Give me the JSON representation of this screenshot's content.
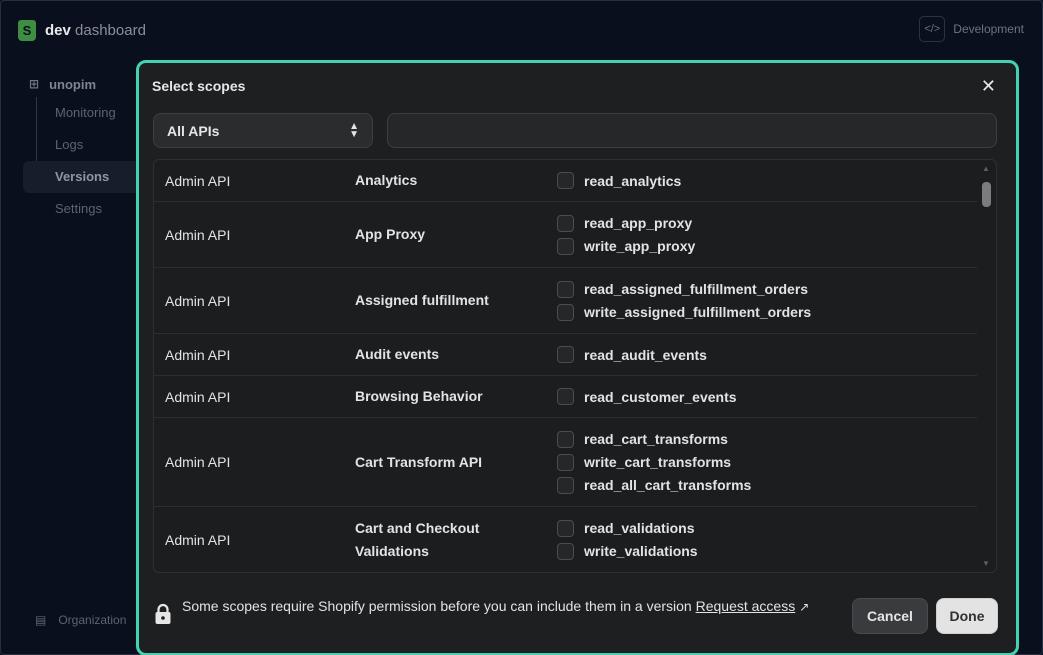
{
  "app": {
    "brand_bold": "dev",
    "brand_rest": " dashboard",
    "env_label": "Development",
    "sidebar": {
      "app_name": "unopim",
      "items": [
        {
          "label": "Monitoring"
        },
        {
          "label": "Logs"
        },
        {
          "label": "Versions"
        },
        {
          "label": "Settings"
        }
      ],
      "org_label": "Organization"
    }
  },
  "modal": {
    "title": "Select scopes",
    "close_glyph": "✕",
    "api_filter": {
      "selected": "All APIs"
    },
    "search": {
      "value": "",
      "placeholder": ""
    },
    "rows": [
      {
        "api": "Admin API",
        "group": "Analytics",
        "scopes": [
          "read_analytics"
        ]
      },
      {
        "api": "Admin API",
        "group": "App Proxy",
        "scopes": [
          "read_app_proxy",
          "write_app_proxy"
        ]
      },
      {
        "api": "Admin API",
        "group": "Assigned fulfillment",
        "scopes": [
          "read_assigned_fulfillment_orders",
          "write_assigned_fulfillment_orders"
        ]
      },
      {
        "api": "Admin API",
        "group": "Audit events",
        "scopes": [
          "read_audit_events"
        ]
      },
      {
        "api": "Admin API",
        "group": "Browsing Behavior",
        "scopes": [
          "read_customer_events"
        ]
      },
      {
        "api": "Admin API",
        "group": "Cart Transform API",
        "scopes": [
          "read_cart_transforms",
          "write_cart_transforms",
          "read_all_cart_transforms"
        ]
      },
      {
        "api": "Admin API",
        "group": "Cart and Checkout Validations",
        "scopes": [
          "read_validations",
          "write_validations"
        ]
      }
    ],
    "footer": {
      "notice": "Some scopes require Shopify permission before you can include them in a version ",
      "link_label": "Request access",
      "cancel_label": "Cancel",
      "done_label": "Done"
    }
  },
  "colors": {
    "accent_border": "#42d4b1",
    "modal_bg": "#1e1f21",
    "done_bg": "#e3e3e3"
  }
}
